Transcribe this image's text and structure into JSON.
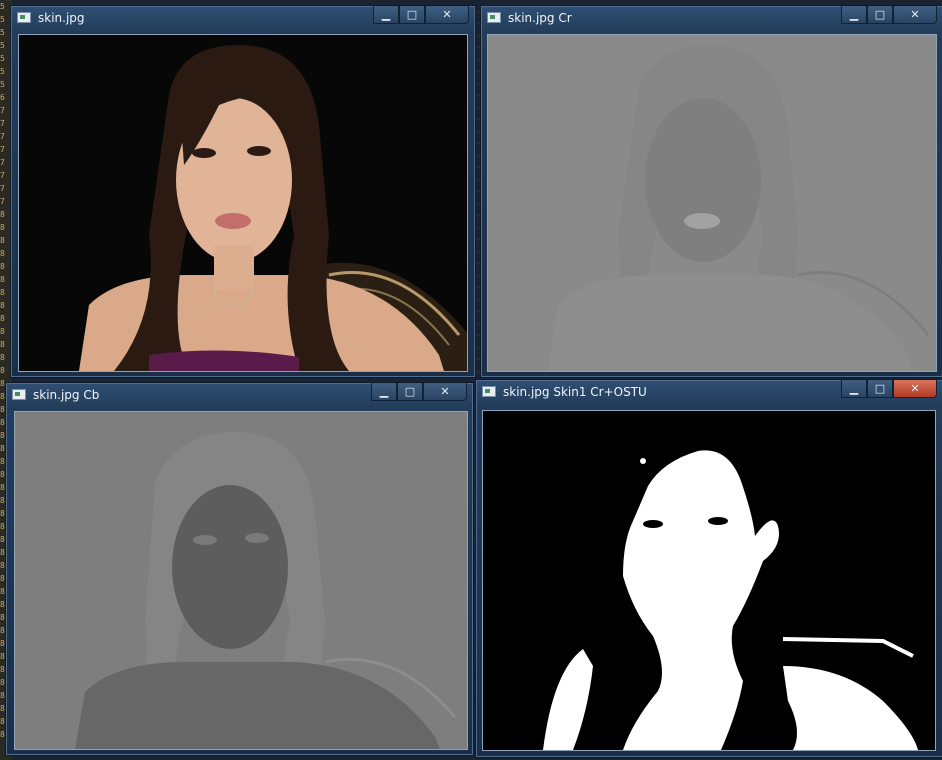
{
  "gutter_digits": [
    "5",
    "5",
    "5",
    "5",
    "5",
    "5",
    "5",
    "6",
    "7",
    "7",
    "7",
    "7",
    "7",
    "7",
    "7",
    "7",
    "8",
    "8",
    "8",
    "8",
    "8",
    "8",
    "8",
    "8",
    "8",
    "8",
    "8",
    "8",
    "8",
    "8",
    "8",
    "8",
    "8",
    "8",
    "8",
    "8",
    "8",
    "8",
    "8",
    "8",
    "8",
    "8",
    "8",
    "8",
    "8",
    "8",
    "8",
    "8",
    "8",
    "8",
    "8",
    "8",
    "8",
    "8",
    "8",
    "8",
    "8"
  ],
  "windows": [
    {
      "title": "skin.jpg",
      "min_label": "▁",
      "max_label": "□",
      "close_label": "✕"
    },
    {
      "title": "skin.jpg Cr",
      "min_label": "▁",
      "max_label": "□",
      "close_label": "✕"
    },
    {
      "title": "skin.jpg Cb",
      "min_label": "▁",
      "max_label": "□",
      "close_label": "✕"
    },
    {
      "title": "skin.jpg Skin1 Cr+OSTU",
      "min_label": "▁",
      "max_label": "□",
      "close_label": "✕"
    }
  ],
  "colors": {
    "titlebar": "#233c5a",
    "close_active": "#c44a30",
    "cr_gray": "#8a8a8a",
    "cb_gray": "#7e7e7e"
  }
}
